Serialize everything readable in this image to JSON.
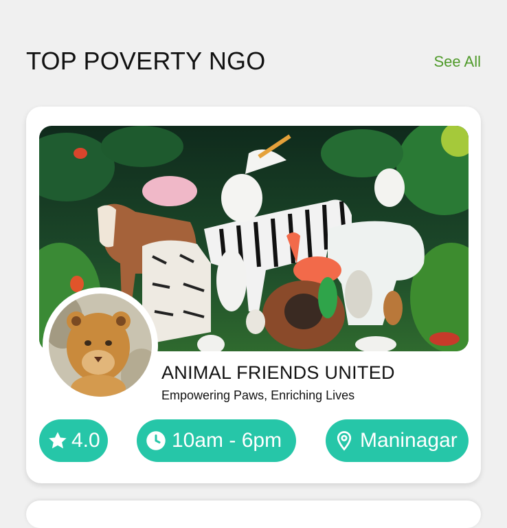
{
  "section": {
    "title": "TOP POVERTY NGO",
    "see_all_label": "See All"
  },
  "ngo_card": {
    "name": "ANIMAL FRIENDS UNITED",
    "tagline": "Empowering Paws, Enriching Lives",
    "rating": "4.0",
    "hours": "10am - 6pm",
    "location": "Maninagar",
    "banner_image": "jungle-animals-banner",
    "avatar_image": "lion-cub-avatar"
  },
  "colors": {
    "accent": "#26c6a8",
    "link": "#4f9a2a",
    "background": "#f0f0f0",
    "card": "#ffffff"
  }
}
